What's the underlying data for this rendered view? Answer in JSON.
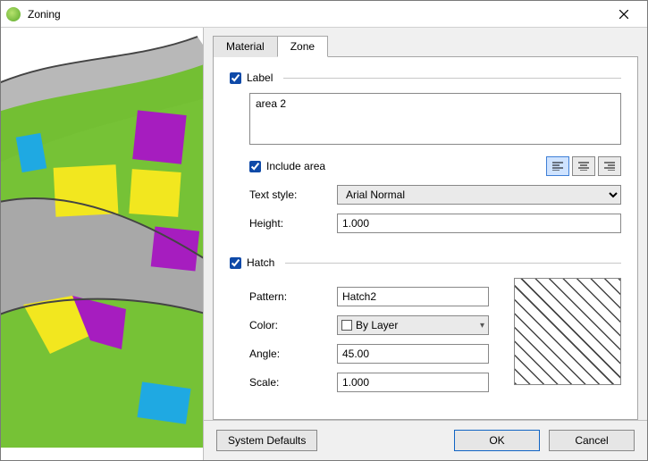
{
  "window": {
    "title": "Zoning"
  },
  "tabs": {
    "material": "Material",
    "zone": "Zone",
    "active": "zone"
  },
  "label_section": {
    "header": "Label",
    "enabled": true,
    "text": "area 2",
    "include_area_label": "Include area",
    "include_area_checked": true,
    "text_style_label": "Text style:",
    "text_style_value": "Arial Normal",
    "height_label": "Height:",
    "height_value": "1.000",
    "alignment": "left"
  },
  "hatch_section": {
    "header": "Hatch",
    "enabled": true,
    "pattern_label": "Pattern:",
    "pattern_value": "Hatch2",
    "color_label": "Color:",
    "color_value": "By Layer",
    "angle_label": "Angle:",
    "angle_value": "45.00",
    "scale_label": "Scale:",
    "scale_value": "1.000"
  },
  "footer": {
    "system_defaults": "System Defaults",
    "ok": "OK",
    "cancel": "Cancel"
  }
}
